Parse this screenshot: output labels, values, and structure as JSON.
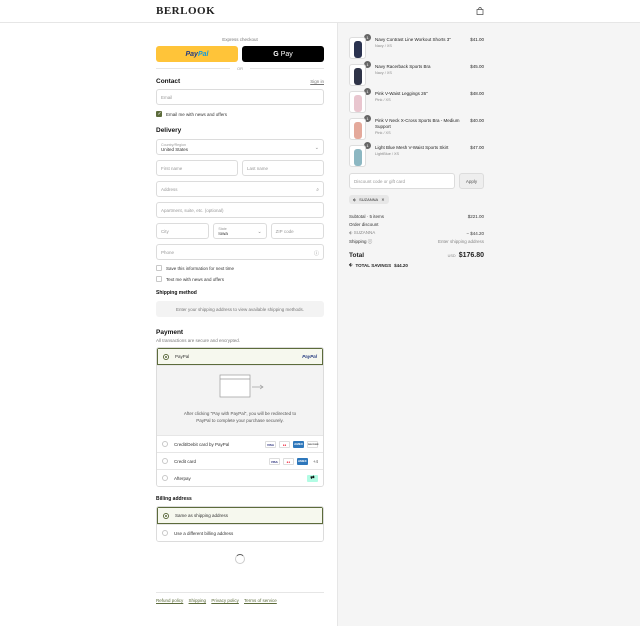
{
  "header": {
    "logo": "BERLOOK",
    "cart_icon": "shopping-bag-icon"
  },
  "express": {
    "label": "Express checkout",
    "paypal_pay": "Pay",
    "paypal_pal": "Pal",
    "gpay_label": "Pay",
    "or_label": "OR"
  },
  "contact": {
    "title": "Contact",
    "sign_in": "Sign in",
    "email_placeholder": "Email",
    "news_label": "Email me with news and offers"
  },
  "delivery": {
    "title": "Delivery",
    "country_label": "Country/Region",
    "country_value": "United States",
    "first_name": "First name",
    "last_name": "Last name",
    "address": "Address",
    "apartment": "Apartment, suite, etc. (optional)",
    "city": "City",
    "state_label": "State",
    "state_value": "Iowa",
    "zip": "ZIP code",
    "phone": "Phone",
    "save_info": "Save this information for next time",
    "text_news": "Text me with news and offers"
  },
  "shipping_method": {
    "title": "Shipping method",
    "placeholder": "Enter your shipping address to view available shipping methods."
  },
  "payment": {
    "title": "Payment",
    "subtitle": "All transactions are secure and encrypted.",
    "options": [
      {
        "label": "PayPal"
      },
      {
        "label": "Credit/Debit card by PayPal"
      },
      {
        "label": "Credit card",
        "more": "+4"
      },
      {
        "label": "Afterpay"
      }
    ],
    "paypal_logo": "PayPal",
    "redirect_line1": "After clicking \"Pay with PayPal\", you will be redirected to",
    "redirect_line2": "PayPal to complete your purchase securely.",
    "card_logos": [
      "VISA",
      "MC",
      "AMEX",
      "DISCOVER"
    ]
  },
  "billing": {
    "title": "Billing address",
    "same": "Same as shipping address",
    "different": "Use a different billing address"
  },
  "footer": {
    "links": [
      "Refund policy",
      "Shipping",
      "Privacy policy",
      "Terms of service"
    ]
  },
  "cart": {
    "items": [
      {
        "name": "Navy Contrast Line Workout Shorts 3\"",
        "variant": "Navy / XS",
        "price": "$41.00",
        "qty": "1",
        "color": "#2b3350"
      },
      {
        "name": "Navy Racerback Sports Bra",
        "variant": "Navy / XS",
        "price": "$45.00",
        "qty": "1",
        "color": "#2f3448"
      },
      {
        "name": "Pink V-Waist Leggings 26\"",
        "variant": "Pink / XS",
        "price": "$48.00",
        "qty": "1",
        "color": "#e9c6cf"
      },
      {
        "name": "Pink V Neck X-Cross Sports Bra - Medium Support",
        "variant": "Pink / XS",
        "price": "$40.00",
        "qty": "1",
        "color": "#e4a99b"
      },
      {
        "name": "Light Blue Mesh V-Waist Sports Skirt",
        "variant": "LightBlue / XS",
        "price": "$47.00",
        "qty": "1",
        "color": "#8cb7c2"
      }
    ],
    "discount_placeholder": "Discount code or gift card",
    "apply": "Apply",
    "code_tag": "SUZANNA",
    "subtotal_label": "Subtotal · 5 items",
    "subtotal_value": "$221.00",
    "order_discount_label": "Order discount",
    "discount_code": "SUZANNA",
    "discount_value": "− $44.20",
    "shipping_label": "Shipping",
    "shipping_value": "Enter shipping address",
    "total_label": "Total",
    "currency": "USD",
    "total_value": "$176.80",
    "savings_label": "TOTAL SAVINGS",
    "savings_value": "$44.20"
  },
  "colors": {
    "accent": "#5c6b3b",
    "paypal_yellow": "#ffc439"
  }
}
